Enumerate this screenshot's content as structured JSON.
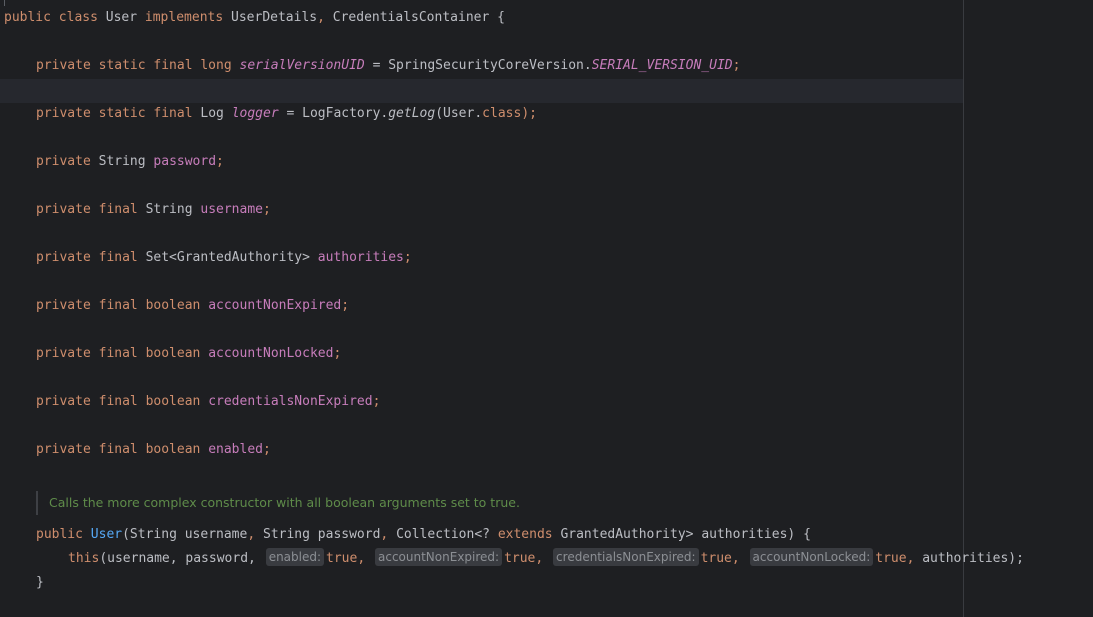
{
  "lines": {
    "l1": {
      "kw1": "public",
      "kw2": "class",
      "name": "User",
      "kw3": "implements",
      "iface1": "UserDetails",
      "comma": ",",
      "iface2": "CredentialsContainer",
      "brace": "{"
    },
    "l2": {
      "kw": "private static final long",
      "field": "serialVersionUID",
      "eq": "=",
      "cls": "SpringSecurityCoreVersion.",
      "const": "SERIAL_VERSION_UID",
      "semi": ";"
    },
    "l3": {
      "kw": "private static final",
      "type": "Log",
      "field": "logger",
      "eq": "=",
      "call": "LogFactory.",
      "method": "getLog",
      "args": "(User.",
      "kwclass": "class",
      "end": ");"
    },
    "l4": {
      "kw": "private",
      "type": "String",
      "field": "password",
      "semi": ";"
    },
    "l5": {
      "kw": "private final",
      "type": "String",
      "field": "username",
      "semi": ";"
    },
    "l6": {
      "kw": "private final",
      "type": "Set<GrantedAuthority>",
      "field": "authorities",
      "semi": ";"
    },
    "l7": {
      "kw": "private final boolean",
      "field": "accountNonExpired",
      "semi": ";"
    },
    "l8": {
      "kw": "private final boolean",
      "field": "accountNonLocked",
      "semi": ";"
    },
    "l9": {
      "kw": "private final boolean",
      "field": "credentialsNonExpired",
      "semi": ";"
    },
    "l10": {
      "kw": "private final boolean",
      "field": "enabled",
      "semi": ";"
    }
  },
  "doc_comment": "Calls the more complex constructor with all boolean arguments set to true.",
  "ctor": {
    "kw": "public",
    "name": "User",
    "p1": "(String username",
    "c1": ",",
    "p2": "String password",
    "c2": ",",
    "p3": "Collection<?",
    "kwext": "extends",
    "p4": "GrantedAuthority> authorities) {"
  },
  "call": {
    "kwthis": "this",
    "args1": "(username, password,",
    "hint1": "enabled:",
    "v1": "true",
    "c1": ",",
    "hint2": "accountNonExpired:",
    "v2": "true",
    "c2": ",",
    "hint3": "credentialsNonExpired:",
    "v3": "true",
    "c3": ",",
    "hint4": "accountNonLocked:",
    "v4": "true",
    "c4": ",",
    "tail": "authorities);"
  },
  "close_brace": "}",
  "colors": {
    "background": "#1e1f22",
    "keyword": "#cf8e6d",
    "field": "#c77dbb",
    "text": "#bcbec4",
    "hint_bg": "#393b40",
    "doc": "#5f8c4a"
  }
}
